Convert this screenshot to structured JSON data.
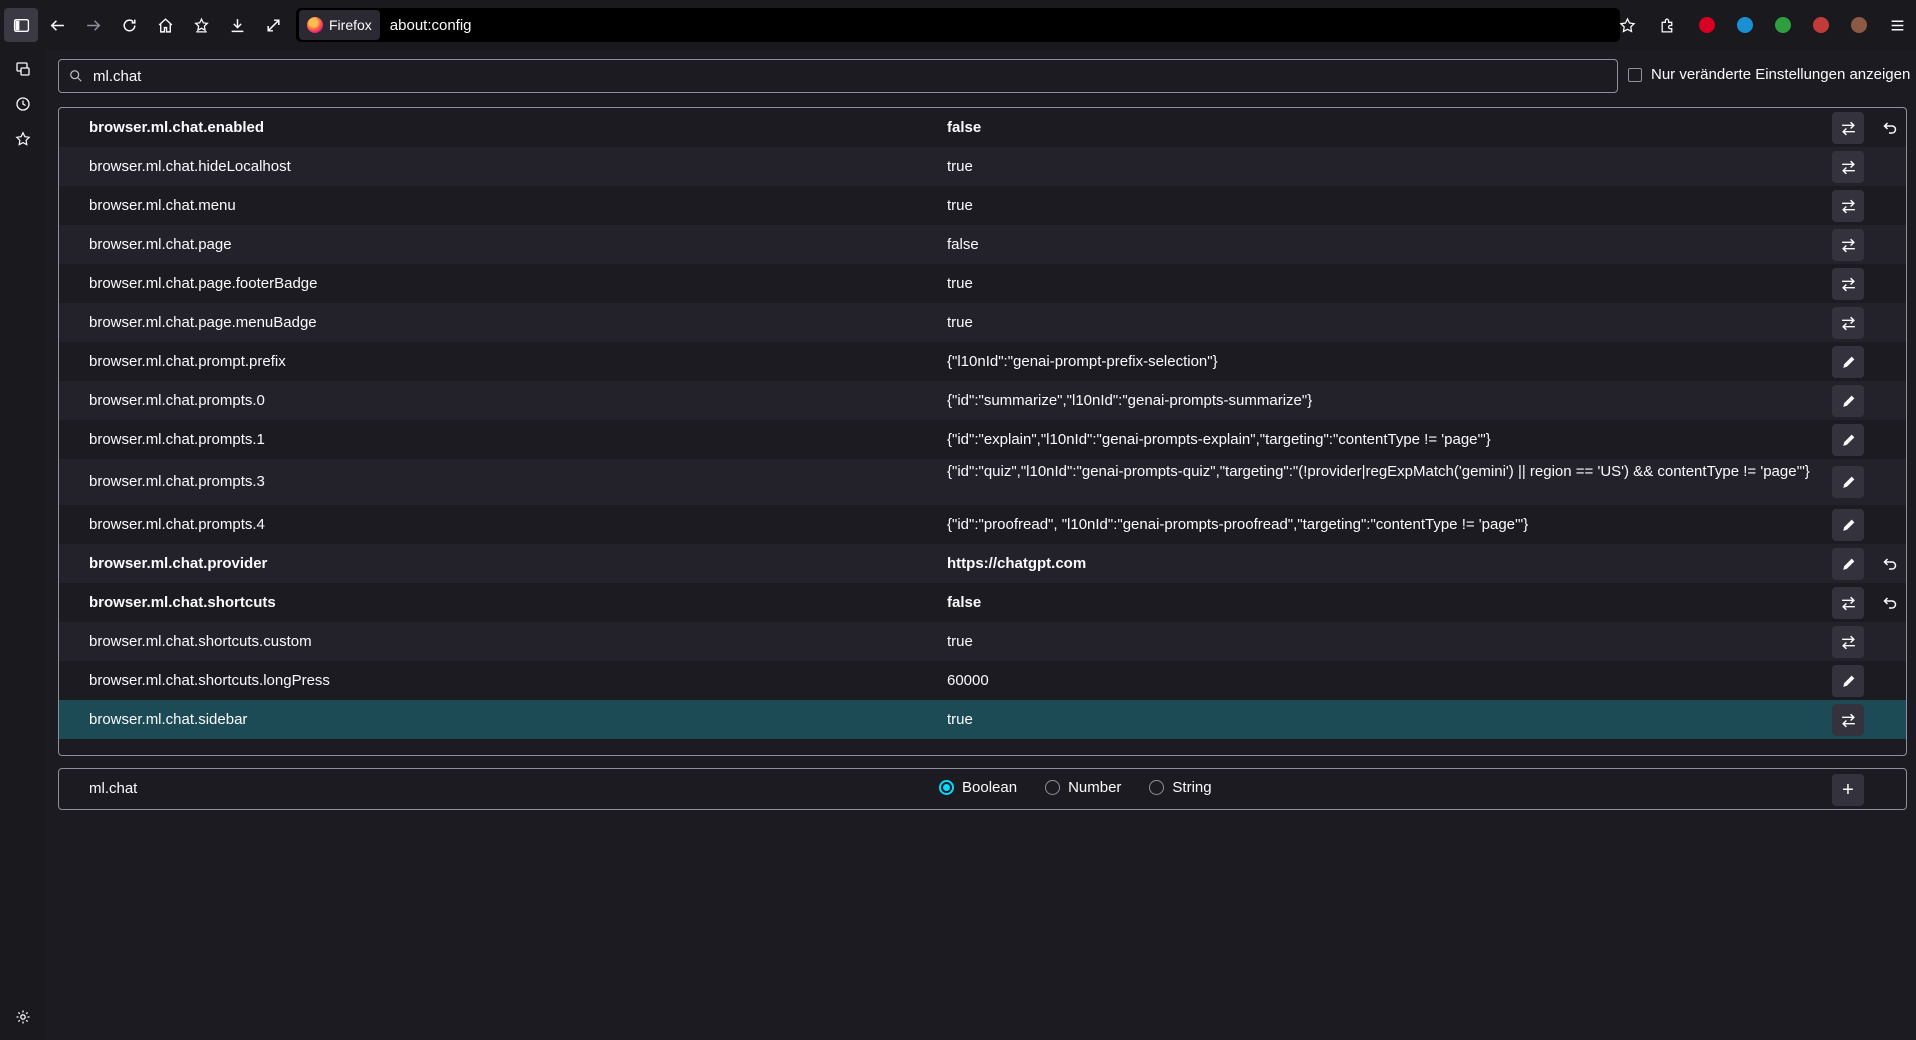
{
  "toolbar": {
    "identity_label": "Firefox",
    "url": "about:config",
    "extension_colors": [
      "#d70022",
      "#1a8fd6",
      "#2e9e3f",
      "#c13b3b",
      "#8a5a44"
    ]
  },
  "search": {
    "value": "ml.chat"
  },
  "modified_filter": {
    "label": "Nur veränderte Einstellungen anzeigen",
    "checked": false
  },
  "prefs": [
    {
      "name": "browser.ml.chat.enabled",
      "value": "false",
      "modified": true,
      "action": "toggle",
      "resettable": true
    },
    {
      "name": "browser.ml.chat.hideLocalhost",
      "value": "true",
      "modified": false,
      "action": "toggle",
      "resettable": false
    },
    {
      "name": "browser.ml.chat.menu",
      "value": "true",
      "modified": false,
      "action": "toggle",
      "resettable": false
    },
    {
      "name": "browser.ml.chat.page",
      "value": "false",
      "modified": false,
      "action": "toggle",
      "resettable": false
    },
    {
      "name": "browser.ml.chat.page.footerBadge",
      "value": "true",
      "modified": false,
      "action": "toggle",
      "resettable": false
    },
    {
      "name": "browser.ml.chat.page.menuBadge",
      "value": "true",
      "modified": false,
      "action": "toggle",
      "resettable": false
    },
    {
      "name": "browser.ml.chat.prompt.prefix",
      "value": "{\"l10nId\":\"genai-prompt-prefix-selection\"}",
      "modified": false,
      "action": "edit",
      "resettable": false
    },
    {
      "name": "browser.ml.chat.prompts.0",
      "value": "{\"id\":\"summarize\",\"l10nId\":\"genai-prompts-summarize\"}",
      "modified": false,
      "action": "edit",
      "resettable": false
    },
    {
      "name": "browser.ml.chat.prompts.1",
      "value": "{\"id\":\"explain\",\"l10nId\":\"genai-prompts-explain\",\"targeting\":\"contentType != 'page'\"}",
      "modified": false,
      "action": "edit",
      "resettable": false
    },
    {
      "name": "browser.ml.chat.prompts.3",
      "value": "{\"id\":\"quiz\",\"l10nId\":\"genai-prompts-quiz\",\"targeting\":\"(!provider|regExpMatch('gemini') || region == 'US') && contentType != 'page'\"}",
      "modified": false,
      "action": "edit",
      "resettable": false
    },
    {
      "name": "browser.ml.chat.prompts.4",
      "value": "{\"id\":\"proofread\", \"l10nId\":\"genai-prompts-proofread\",\"targeting\":\"contentType != 'page'\"}",
      "modified": false,
      "action": "edit",
      "resettable": false
    },
    {
      "name": "browser.ml.chat.provider",
      "value": "https://chatgpt.com",
      "modified": true,
      "action": "edit",
      "resettable": true
    },
    {
      "name": "browser.ml.chat.shortcuts",
      "value": "false",
      "modified": true,
      "action": "toggle",
      "resettable": true
    },
    {
      "name": "browser.ml.chat.shortcuts.custom",
      "value": "true",
      "modified": false,
      "action": "toggle",
      "resettable": false
    },
    {
      "name": "browser.ml.chat.shortcuts.longPress",
      "value": "60000",
      "modified": false,
      "action": "edit",
      "resettable": false
    },
    {
      "name": "browser.ml.chat.sidebar",
      "value": "true",
      "modified": false,
      "action": "toggle",
      "resettable": false,
      "selected": true
    }
  ],
  "add_row": {
    "name": "ml.chat",
    "types": [
      {
        "label": "Boolean",
        "selected": true
      },
      {
        "label": "Number",
        "selected": false
      },
      {
        "label": "String",
        "selected": false
      }
    ],
    "add_symbol": "+"
  }
}
